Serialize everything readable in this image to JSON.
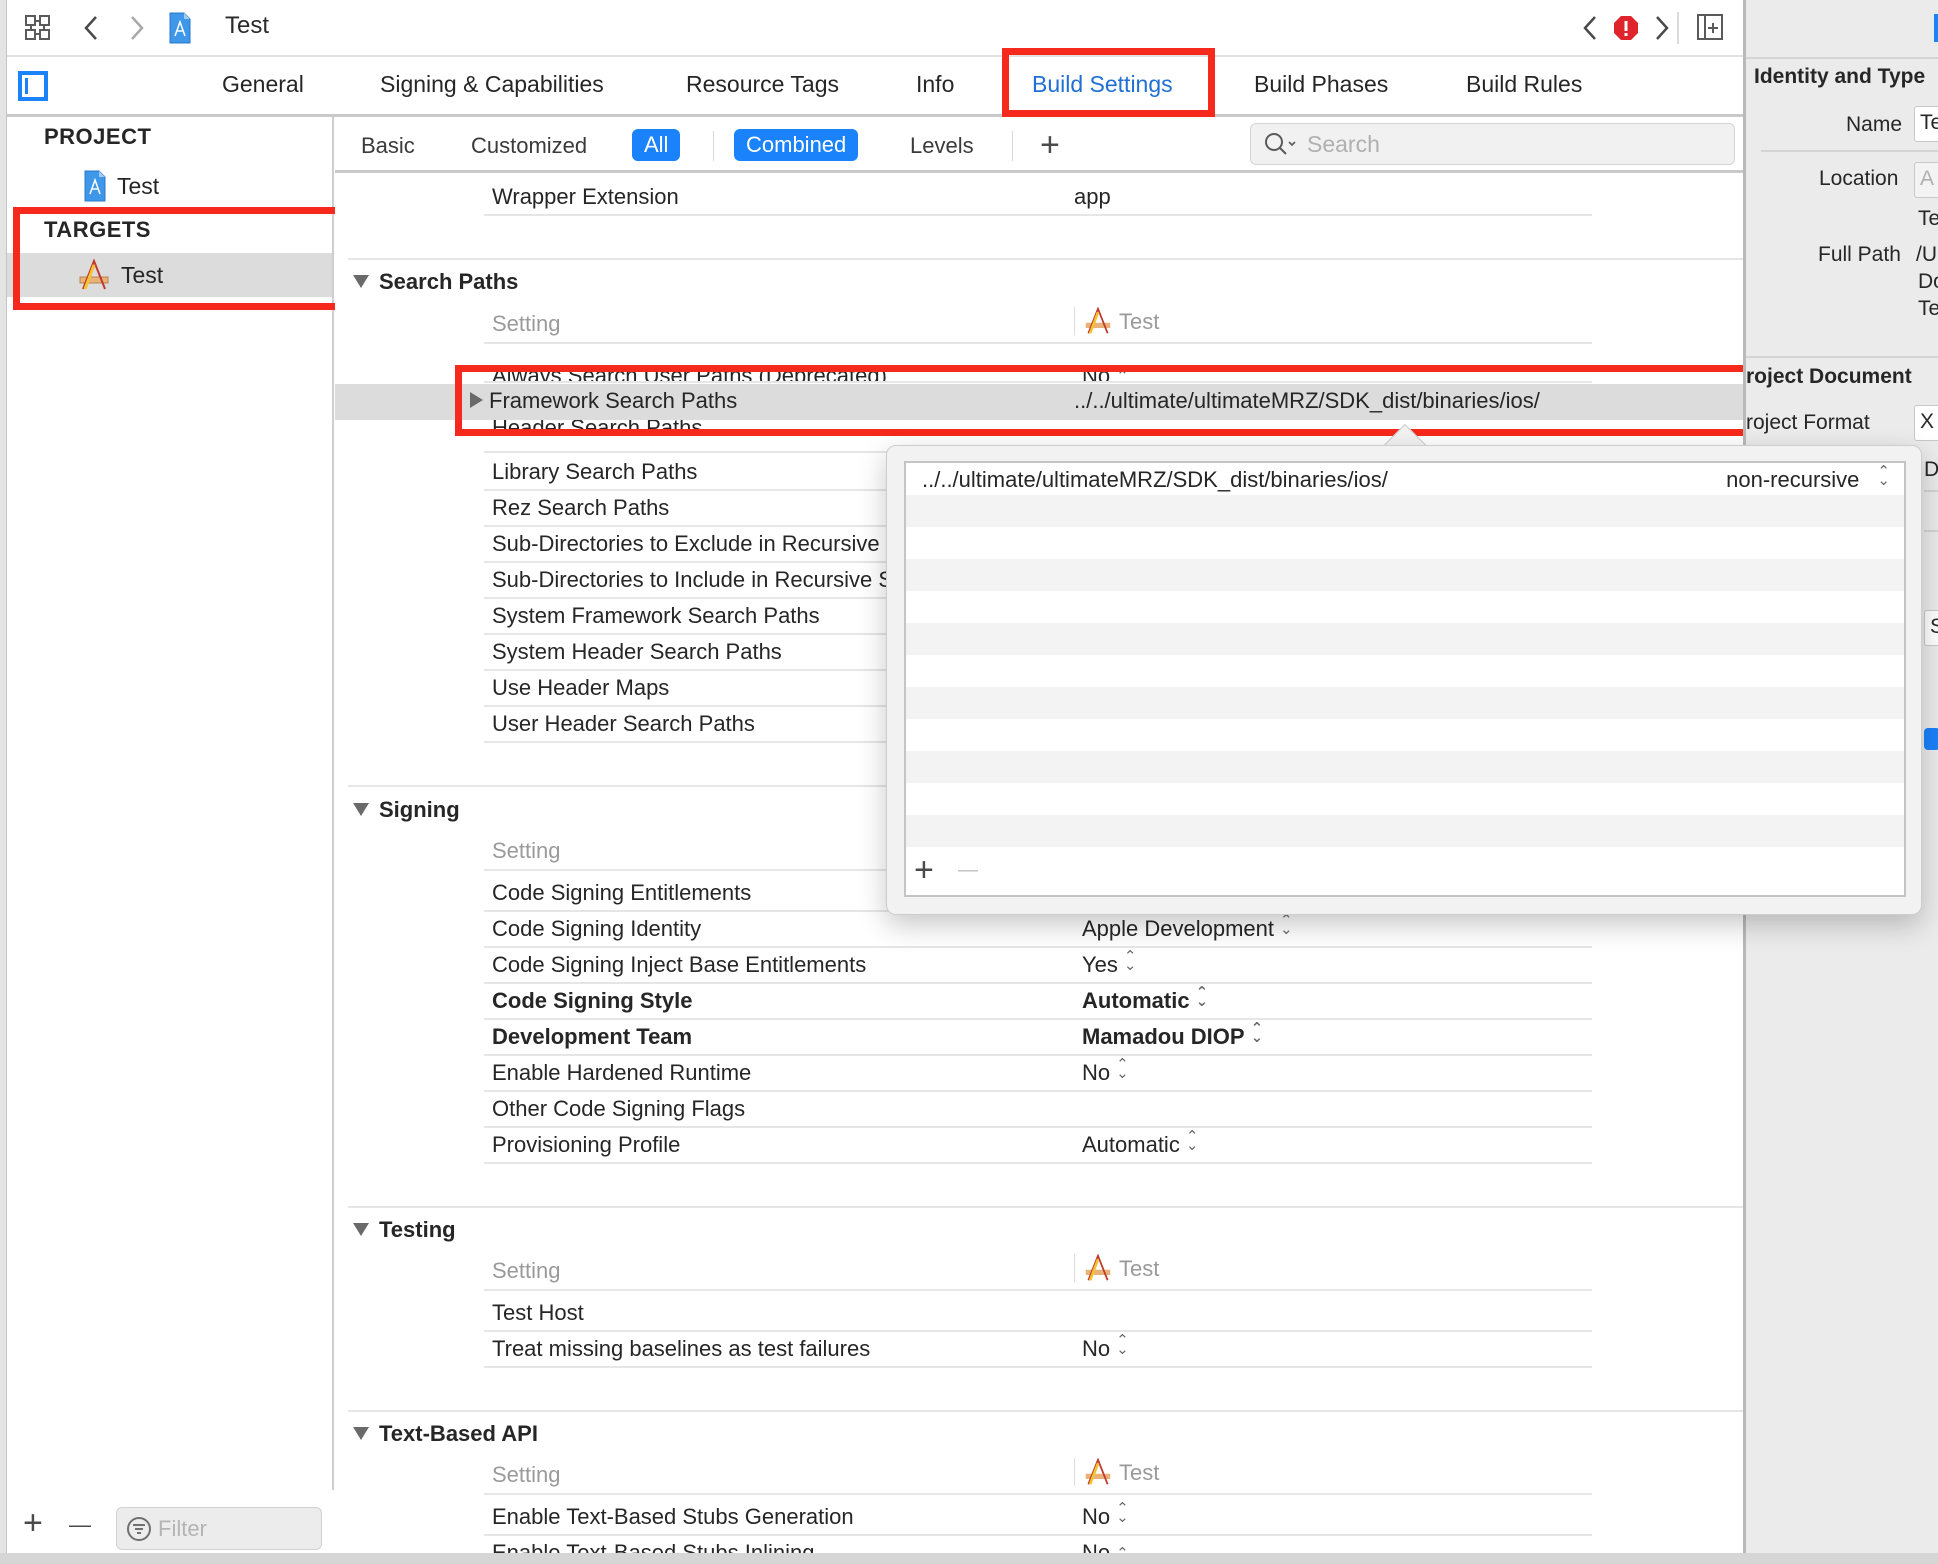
{
  "toolbar": {
    "breadcrumb_title": "Test",
    "icons": [
      "grid-icon",
      "back-arrow-icon",
      "forward-arrow-icon",
      "project-file-icon",
      "issue-prev-icon",
      "error-icon",
      "issue-next-icon",
      "add-editor-icon"
    ]
  },
  "tabs": [
    {
      "label": "General",
      "active": false
    },
    {
      "label": "Signing & Capabilities",
      "active": false
    },
    {
      "label": "Resource Tags",
      "active": false
    },
    {
      "label": "Info",
      "active": false
    },
    {
      "label": "Build Settings",
      "active": true
    },
    {
      "label": "Build Phases",
      "active": false
    },
    {
      "label": "Build Rules",
      "active": false
    }
  ],
  "sidebar": {
    "project_heading": "PROJECT",
    "project_item": "Test",
    "targets_heading": "TARGETS",
    "target_item": "Test",
    "filter_placeholder": "Filter",
    "add_label": "+",
    "remove_label": "—"
  },
  "filterbar": {
    "basic": "Basic",
    "customized": "Customized",
    "all": "All",
    "combined": "Combined",
    "levels": "Levels",
    "add": "+",
    "search_placeholder": "Search"
  },
  "settings": {
    "packaging_tail": {
      "name": "Wrapper Extension",
      "value": "app"
    },
    "column_setting": "Setting",
    "column_target": "Test",
    "search_paths": {
      "title": "Search Paths",
      "rows": [
        {
          "name": "Always Search User Paths (Deprecated)",
          "value": "No"
        },
        {
          "name": "Framework Search Paths",
          "value": "../../ultimate/ultimateMRZ/SDK_dist/binaries/ios/"
        },
        {
          "name": "Header Search Paths",
          "value": ""
        },
        {
          "name": "Library Search Paths",
          "value": ""
        },
        {
          "name": "Rez Search Paths",
          "value": ""
        },
        {
          "name": "Sub-Directories to Exclude in Recursive Searches",
          "value": ""
        },
        {
          "name": "Sub-Directories to Include in Recursive Searches",
          "value": ""
        },
        {
          "name": "System Framework Search Paths",
          "value": ""
        },
        {
          "name": "System Header Search Paths",
          "value": ""
        },
        {
          "name": "Use Header Maps",
          "value": ""
        },
        {
          "name": "User Header Search Paths",
          "value": ""
        }
      ]
    },
    "signing": {
      "title": "Signing",
      "rows": [
        {
          "name": "Code Signing Entitlements",
          "value": ""
        },
        {
          "name": "Code Signing Identity",
          "value": "Apple Development"
        },
        {
          "name": "Code Signing Inject Base Entitlements",
          "value": "Yes"
        },
        {
          "name": "Code Signing Style",
          "value": "Automatic"
        },
        {
          "name": "Development Team",
          "value": "Mamadou DIOP"
        },
        {
          "name": "Enable Hardened Runtime",
          "value": "No"
        },
        {
          "name": "Other Code Signing Flags",
          "value": ""
        },
        {
          "name": "Provisioning Profile",
          "value": "Automatic"
        }
      ]
    },
    "testing": {
      "title": "Testing",
      "rows": [
        {
          "name": "Test Host",
          "value": ""
        },
        {
          "name": "Treat missing baselines as test failures",
          "value": "No"
        }
      ]
    },
    "text_based_api": {
      "title": "Text-Based API",
      "rows": [
        {
          "name": "Enable Text-Based Stubs Generation",
          "value": "No"
        },
        {
          "name": "Enable Text-Based Stubs Inlining",
          "value": "No"
        }
      ]
    }
  },
  "popover": {
    "entries": [
      {
        "path": "../../ultimate/ultimateMRZ/SDK_dist/binaries/ios/",
        "mode": "non-recursive"
      }
    ],
    "add_label": "+",
    "remove_label": "—"
  },
  "inspector": {
    "identity_heading": "Identity and Type",
    "name_label": "Name",
    "name_value": "Te",
    "location_label": "Location",
    "location_value": "A",
    "location_sub": "Te",
    "full_path_label": "Full Path",
    "full_path_lines": [
      "/U",
      "Do",
      "Te"
    ],
    "project_doc_heading": "Project Document",
    "project_format_label": "Project Format",
    "project_format_value": "X",
    "partial_1": "Do",
    "partial_2": "S"
  },
  "colors": {
    "accent": "#1a82fb",
    "annotation_red": "#f5291c",
    "error_red": "#e0242b",
    "active_tab": "#1f6fd6"
  }
}
